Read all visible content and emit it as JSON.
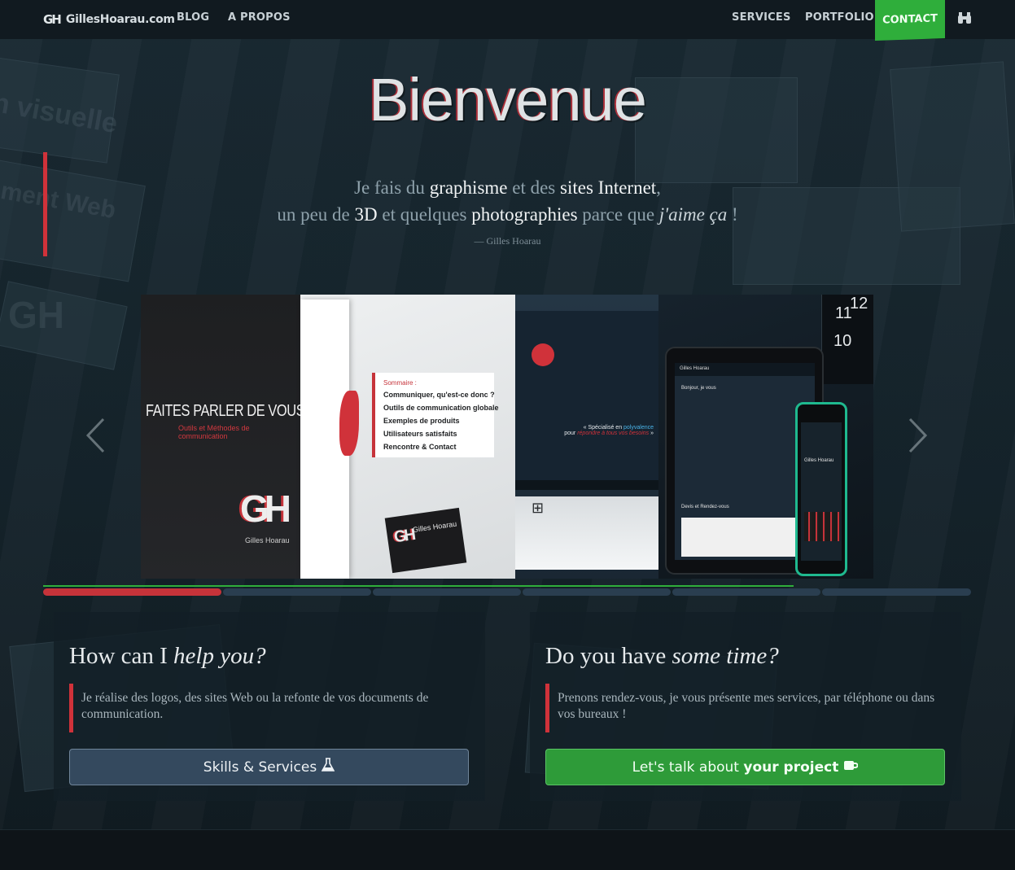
{
  "header": {
    "logo_mark": "GH",
    "logo_text": "GillesHoarau.com",
    "nav_left": [
      "BLOG",
      "A PROPOS"
    ],
    "nav_right": [
      "SERVICES",
      "PORTFOLIO"
    ],
    "contact_label": "CONTACT",
    "search_icon": "binoculars-icon",
    "accent_green": "#2fae3b"
  },
  "hero": {
    "title": "Bienvenue",
    "tagline": {
      "p1": "Je fais du ",
      "h1": "graphisme",
      "p2": " et des ",
      "h2": "sites Internet",
      "p3": ",",
      "p4": "un peu de ",
      "h3": "3D",
      "p5": " et quelques ",
      "h4": "photographies",
      "p6": " parce que ",
      "em": "j'aime ça",
      "p7": " !"
    },
    "author": "— Gilles Hoarau",
    "accent_red": "#d0323a"
  },
  "carousel": {
    "slide1": {
      "heading": "FAITES PARLER DE VOUS !",
      "sub": "Outils et Méthodes de communication",
      "logo": "GH",
      "name": "Gilles Hoarau"
    },
    "slide2": {
      "summary_title": "Sommaire :",
      "items": [
        "Communiquer, qu'est-ce donc ?",
        "Outils de communication globale",
        "Exemples de produits",
        "Utilisateurs satisfaits",
        "Rencontre & Contact"
      ],
      "card_logo": "GH",
      "card_name": "Gilles Hoarau"
    },
    "slide3": {
      "text_line1": "« Spécialisé en ",
      "text_hl": "polyvalence",
      "text_line2": "pour ",
      "text_em": "répondre à tous vos besoins",
      "text_end": " »"
    },
    "slide4": {
      "tablet_title": "Gilles Hoarau",
      "tablet_greeting": "Bonjour, je vous",
      "tablet_form_title": "Devis et Rendez-vous",
      "phone_title": "Gilles Hoarau",
      "clock_numbers": [
        "12",
        "11",
        "10"
      ]
    },
    "indicator_count": 6,
    "active_index": 0,
    "progress": 0.81
  },
  "panels": [
    {
      "title_plain": "How can I ",
      "title_em": "help you?",
      "description": "Je réalise des logos, des sites Web ou la refonte de vos documents de communication.",
      "button_label": "Skills & Services",
      "button_icon": "flask-icon"
    },
    {
      "title_plain": "Do you have ",
      "title_em": "some time?",
      "description": "Prenons rendez-vous, je vous présente mes services, par téléphone ou dans vos bureaux !",
      "button_label_plain": "Let's talk about ",
      "button_label_bold": "your project",
      "button_icon": "coffee-icon"
    }
  ]
}
